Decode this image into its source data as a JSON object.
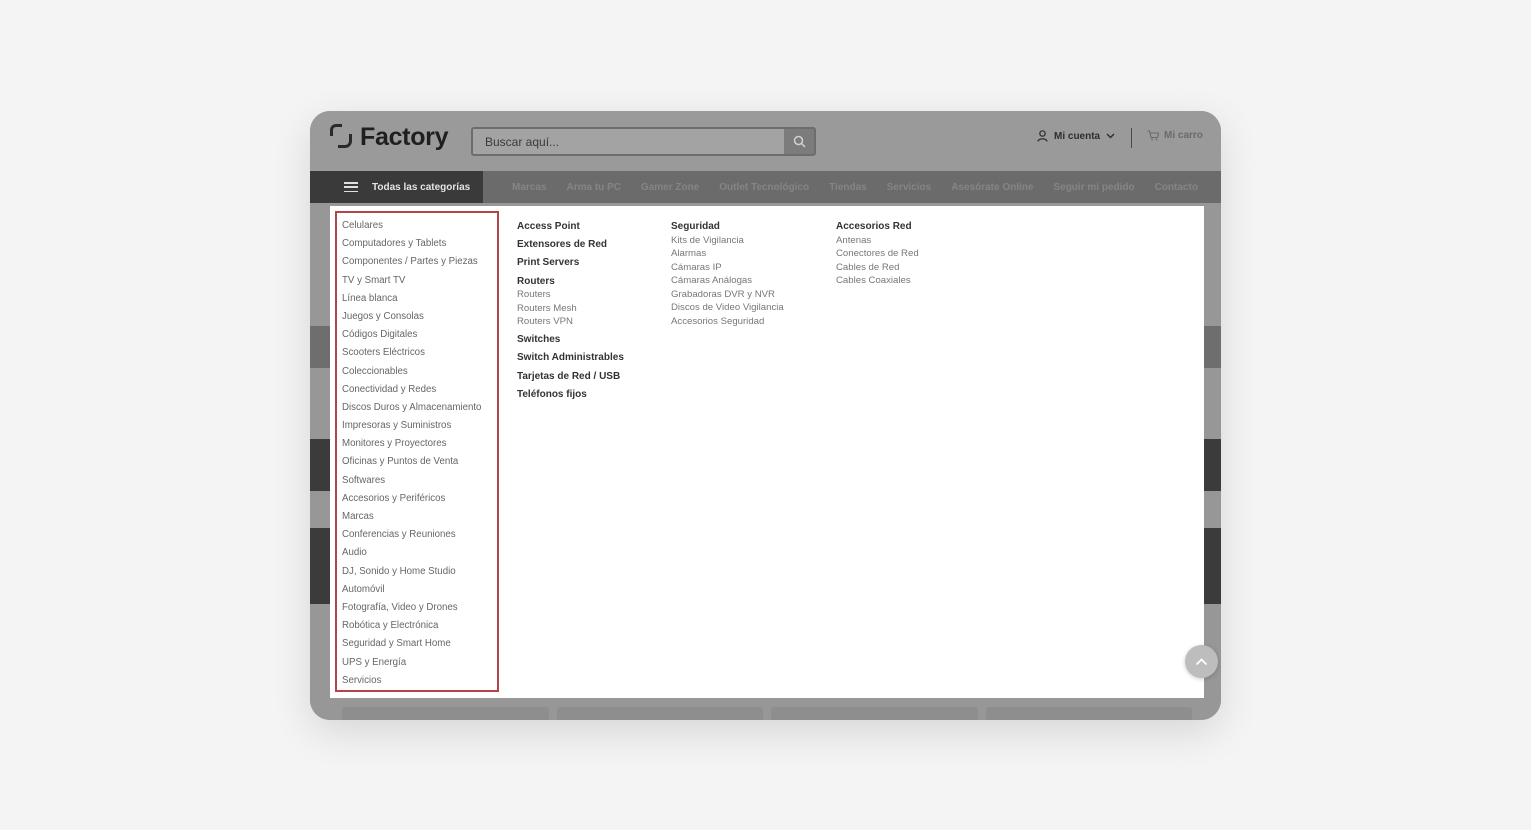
{
  "header": {
    "logo_text": "Factory",
    "search_placeholder": "Buscar aquí...",
    "account_label": "Mi cuenta",
    "cart_label": "Mi carro"
  },
  "nav": {
    "categories_label": "Todas las categorías",
    "links": [
      "Marcas",
      "Arma tu PC",
      "Gamer Zone",
      "Outlet Tecnológico",
      "Tiendas",
      "Servicios",
      "Asesórate Online",
      "Seguir mi pedido",
      "Contacto"
    ]
  },
  "menu": {
    "categories": [
      "Celulares",
      "Computadores y Tablets",
      "Componentes / Partes y Piezas",
      "TV y Smart TV",
      "Línea blanca",
      "Juegos y Consolas",
      "Códigos Digitales",
      "Scooters Eléctricos",
      "Coleccionables",
      "Conectividad y Redes",
      "Discos Duros y Almacenamiento",
      "Impresoras y Suministros",
      "Monitores y Proyectores",
      "Oficinas y Puntos de Venta",
      "Softwares",
      "Accesorios y Periféricos",
      "Marcas",
      "Conferencias y Reuniones",
      "Audio",
      "DJ, Sonido y Home Studio",
      "Automóvil",
      "Fotografía, Video y Drones",
      "Robótica y Electrónica",
      "Seguridad y Smart Home",
      "UPS y Energía",
      "Servicios"
    ],
    "col1": {
      "access_point": "Access Point",
      "extensores": "Extensores de Red",
      "print_servers": "Print Servers",
      "routers": "Routers",
      "routers_sub": [
        "Routers",
        "Routers Mesh",
        "Routers VPN"
      ],
      "switches": "Switches",
      "switch_admin": "Switch Administrables",
      "tarjetas": "Tarjetas de Red / USB",
      "telefonos": "Teléfonos fijos"
    },
    "col2": {
      "heading": "Seguridad",
      "items": [
        "Kits de Vigilancia",
        "Alarmas",
        "Cámaras IP",
        "Cámaras Análogas",
        "Grabadoras DVR y NVR",
        "Discos de Video Vigilancia",
        "Accesorios Seguridad"
      ]
    },
    "col3": {
      "heading": "Accesorios Red",
      "items": [
        "Antenas",
        "Conectores de Red",
        "Cables de Red",
        "Cables Coaxiales"
      ]
    }
  }
}
